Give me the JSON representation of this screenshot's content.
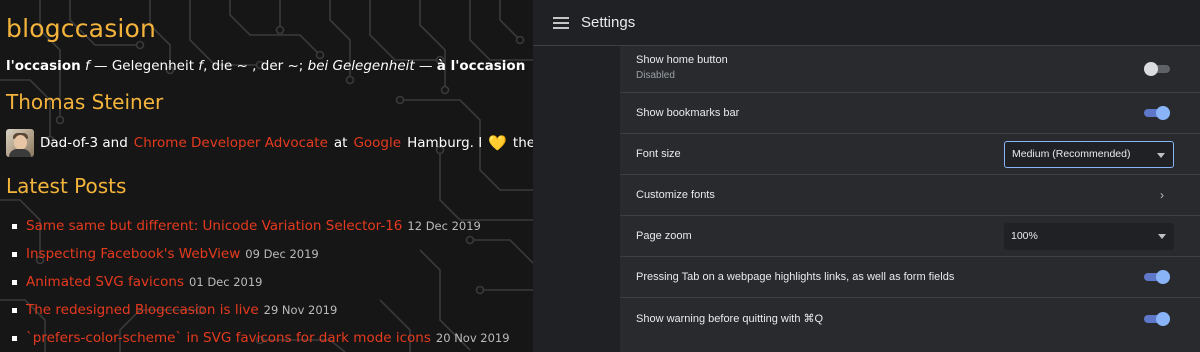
{
  "blog": {
    "title": "blogccasion",
    "tagline": {
      "part1": "l'occasion",
      "part2": " f",
      "part3": " — Gelegenheit ",
      "part4": "f",
      "part5": ", die ~ , der ~; ",
      "part6": "bei Gelegenheit",
      "part7": " — ",
      "part8": "à l'occasion"
    },
    "author": "Thomas Steiner",
    "bio": {
      "pre": "Dad-of-3 and",
      "role_link": "Chrome Developer Advocate",
      "at": "at",
      "company_link": "Google",
      "city": "Hamburg. I",
      "heart": "💛",
      "post": "the Web!"
    },
    "posts_heading": "Latest Posts",
    "posts": [
      {
        "title": "Same same but different: Unicode Variation Selector-16",
        "date": "12 Dec 2019"
      },
      {
        "title": "Inspecting Facebook's WebView",
        "date": "09 Dec 2019"
      },
      {
        "title": "Animated SVG favicons",
        "date": "01 Dec 2019"
      },
      {
        "title": "The redesigned Blogccasion is live",
        "date": "29 Nov 2019"
      },
      {
        "title": "`prefers-color-scheme` in SVG favicons for dark mode icons",
        "date": "20 Nov 2019"
      }
    ],
    "colors": {
      "accent": "#f4b43c",
      "link": "#e63a1e",
      "background": "#161616"
    }
  },
  "settings": {
    "title": "Settings",
    "rows": {
      "home_button": {
        "label": "Show home button",
        "sub": "Disabled",
        "state": "off"
      },
      "bookmarks_bar": {
        "label": "Show bookmarks bar",
        "state": "on"
      },
      "font_size": {
        "label": "Font size",
        "value": "Medium (Recommended)"
      },
      "customize_fonts": {
        "label": "Customize fonts",
        "chevron": "›"
      },
      "page_zoom": {
        "label": "Page zoom",
        "value": "100%"
      },
      "tab_highlight": {
        "label": "Pressing Tab on a webpage highlights links, as well as form fields",
        "state": "on"
      },
      "quit_warning": {
        "label": "Show warning before quitting with ⌘Q",
        "state": "on"
      }
    },
    "colors": {
      "background": "#202124",
      "card": "#292a2d",
      "toggle_on": "#8ab4f8"
    }
  }
}
